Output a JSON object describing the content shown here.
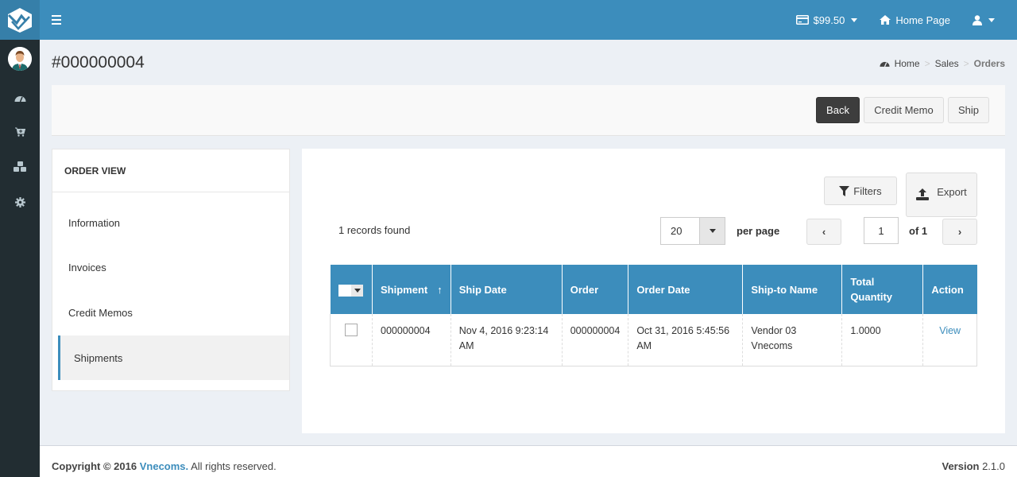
{
  "header": {
    "balance": "$99.50",
    "home_link": "Home Page",
    "colors": {
      "primary": "#3c8dbc",
      "logo_bg": "#367fa9",
      "sidebar_bg": "#222d32"
    }
  },
  "sidebar": {
    "items": [
      {
        "icon": "dashboard-icon"
      },
      {
        "icon": "cart-icon"
      },
      {
        "icon": "cubes-icon"
      },
      {
        "icon": "gear-icon"
      }
    ]
  },
  "page": {
    "title": "#000000004",
    "breadcrumb": [
      "Home",
      "Sales",
      "Orders"
    ]
  },
  "actions": {
    "back": "Back",
    "credit_memo": "Credit Memo",
    "ship": "Ship"
  },
  "order_view": {
    "title": "ORDER VIEW",
    "items": [
      "Information",
      "Invoices",
      "Credit Memos",
      "Shipments"
    ],
    "active": "Shipments"
  },
  "grid": {
    "filters_label": "Filters",
    "export_label": "Export",
    "records_found": "1 records found",
    "per_page_value": "20",
    "per_page_label": "per page",
    "current_page": "1",
    "of_pages": "of 1",
    "columns": [
      "Shipment",
      "Ship Date",
      "Order",
      "Order Date",
      "Ship-to Name",
      "Total Quantity",
      "Action"
    ],
    "sort_indicator": "↑",
    "rows": [
      {
        "shipment": "000000004",
        "ship_date": "Nov 4, 2016 9:23:14 AM",
        "order": "000000004",
        "order_date": "Oct 31, 2016 5:45:56 AM",
        "ship_to": "Vendor 03 Vnecoms",
        "total_qty": "1.0000",
        "action": "View"
      }
    ]
  },
  "footer": {
    "copyright_prefix": "Copyright © 2016",
    "brand": "Vnecoms.",
    "rights": "All rights reserved.",
    "version_label": "Version",
    "version": "2.1.0"
  }
}
